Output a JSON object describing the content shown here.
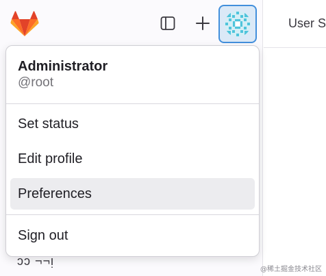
{
  "header": {
    "right_text": "User S"
  },
  "sidebar": {
    "peek_text": "ɔɔ  ¬¬ᴉ"
  },
  "dropdown": {
    "user_name": "Administrator",
    "user_handle": "@root",
    "items": [
      {
        "label": "Set status"
      },
      {
        "label": "Edit profile"
      },
      {
        "label": "Preferences",
        "highlighted": true
      },
      {
        "label": "Sign out"
      }
    ]
  },
  "watermark": "@稀土掘金技术社区",
  "icons": {
    "logo": "gitlab-logo-icon",
    "sidebar_toggle": "sidebar-toggle-icon",
    "create": "plus-icon",
    "avatar": "user-avatar"
  },
  "colors": {
    "accent_border": "#428fdc",
    "highlight_bg": "#ececef",
    "text_primary": "#1f1e24",
    "text_secondary": "#737278",
    "logo_orange": "#fc6d26",
    "logo_red": "#e24329",
    "logo_amber": "#fca326"
  }
}
